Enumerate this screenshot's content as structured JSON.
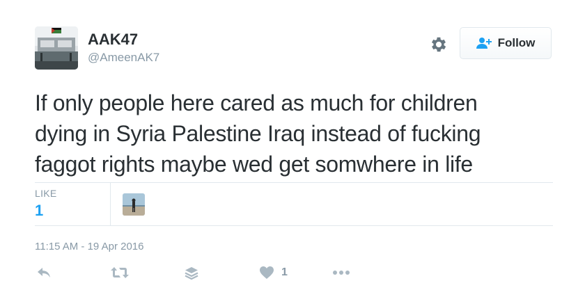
{
  "user": {
    "name": "AAK47",
    "handle": "@AmeenAK7"
  },
  "follow_button": {
    "label": "Follow"
  },
  "tweet": {
    "lines": [
      "If only people here cared as much for children",
      "dying in Syria Palestine Iraq instead of fucking",
      "faggot rights maybe wed get somwhere in life"
    ],
    "timestamp": "11:15 AM - 19 Apr 2016"
  },
  "stats": {
    "like_label": "LIKE",
    "like_count": "1"
  },
  "actions": {
    "like_count": "1",
    "icons": [
      "reply-icon",
      "retweet-icon",
      "stack-icon",
      "heart-icon",
      "more-icon"
    ]
  },
  "colors": {
    "link_blue": "#1da1f2",
    "muted_gray": "#8899a6",
    "text": "#292f33",
    "divider": "#e1e8ed"
  }
}
